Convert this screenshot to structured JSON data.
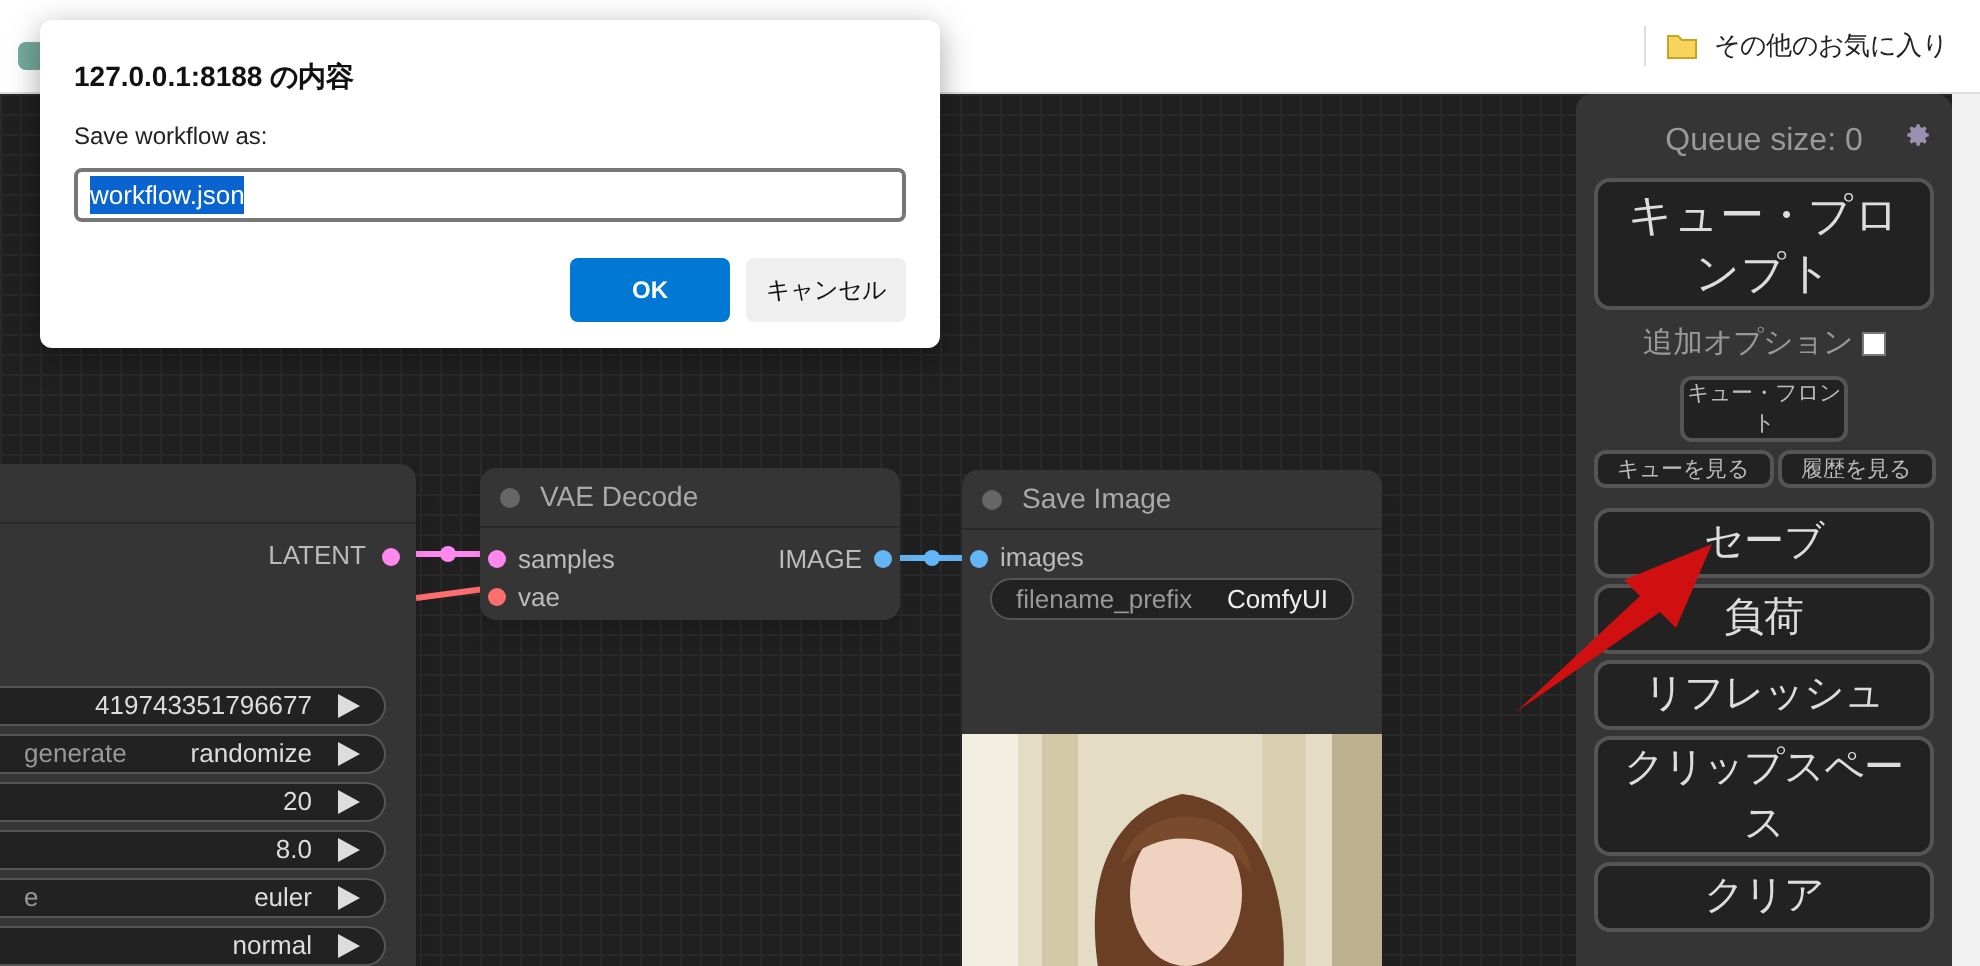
{
  "browser": {
    "bookmark": "その他のお気に入り"
  },
  "dialog": {
    "title": "127.0.0.1:8188 の内容",
    "message": "Save workflow as:",
    "input_value": "workflow.json",
    "buttons": [
      "OK",
      "キャンセル"
    ]
  },
  "nodes": [
    {
      "kind": "sampler",
      "outputs": [
        {
          "name": "LATENT",
          "color": "#ff88ee"
        }
      ],
      "widgets": [
        {
          "value": "419743351796677"
        },
        {
          "label": "generate",
          "value": "randomize"
        },
        {
          "value": "20"
        },
        {
          "value": "8.0"
        },
        {
          "label": "e",
          "value": "euler"
        },
        {
          "value": "normal"
        }
      ]
    },
    {
      "kind": "vae_decode",
      "title": "VAE Decode",
      "inputs": [
        {
          "name": "samples",
          "color": "#ff88ee"
        },
        {
          "name": "vae",
          "color": "#ff6e6e"
        }
      ],
      "outputs": [
        {
          "name": "IMAGE",
          "color": "#64b5f6"
        }
      ]
    },
    {
      "kind": "save_image",
      "title": "Save Image",
      "inputs": [
        {
          "name": "images",
          "color": "#64b5f6"
        }
      ],
      "widgets": [
        {
          "label": "filename_prefix",
          "value": "ComfyUI"
        }
      ],
      "preview": {
        "kind": "picture"
      }
    }
  ],
  "panel": {
    "queue_size": "Queue size: 0",
    "queue_button": "キュー・プロンプト",
    "extra_options": {
      "label": "追加オプション",
      "checked": false
    },
    "small_buttons": [
      "キュー・フロント",
      "キューを見る",
      "履歴を見る"
    ],
    "buttons": [
      "セーブ",
      "負荷",
      "リフレッシュ",
      "クリップスペース",
      "クリア"
    ]
  }
}
